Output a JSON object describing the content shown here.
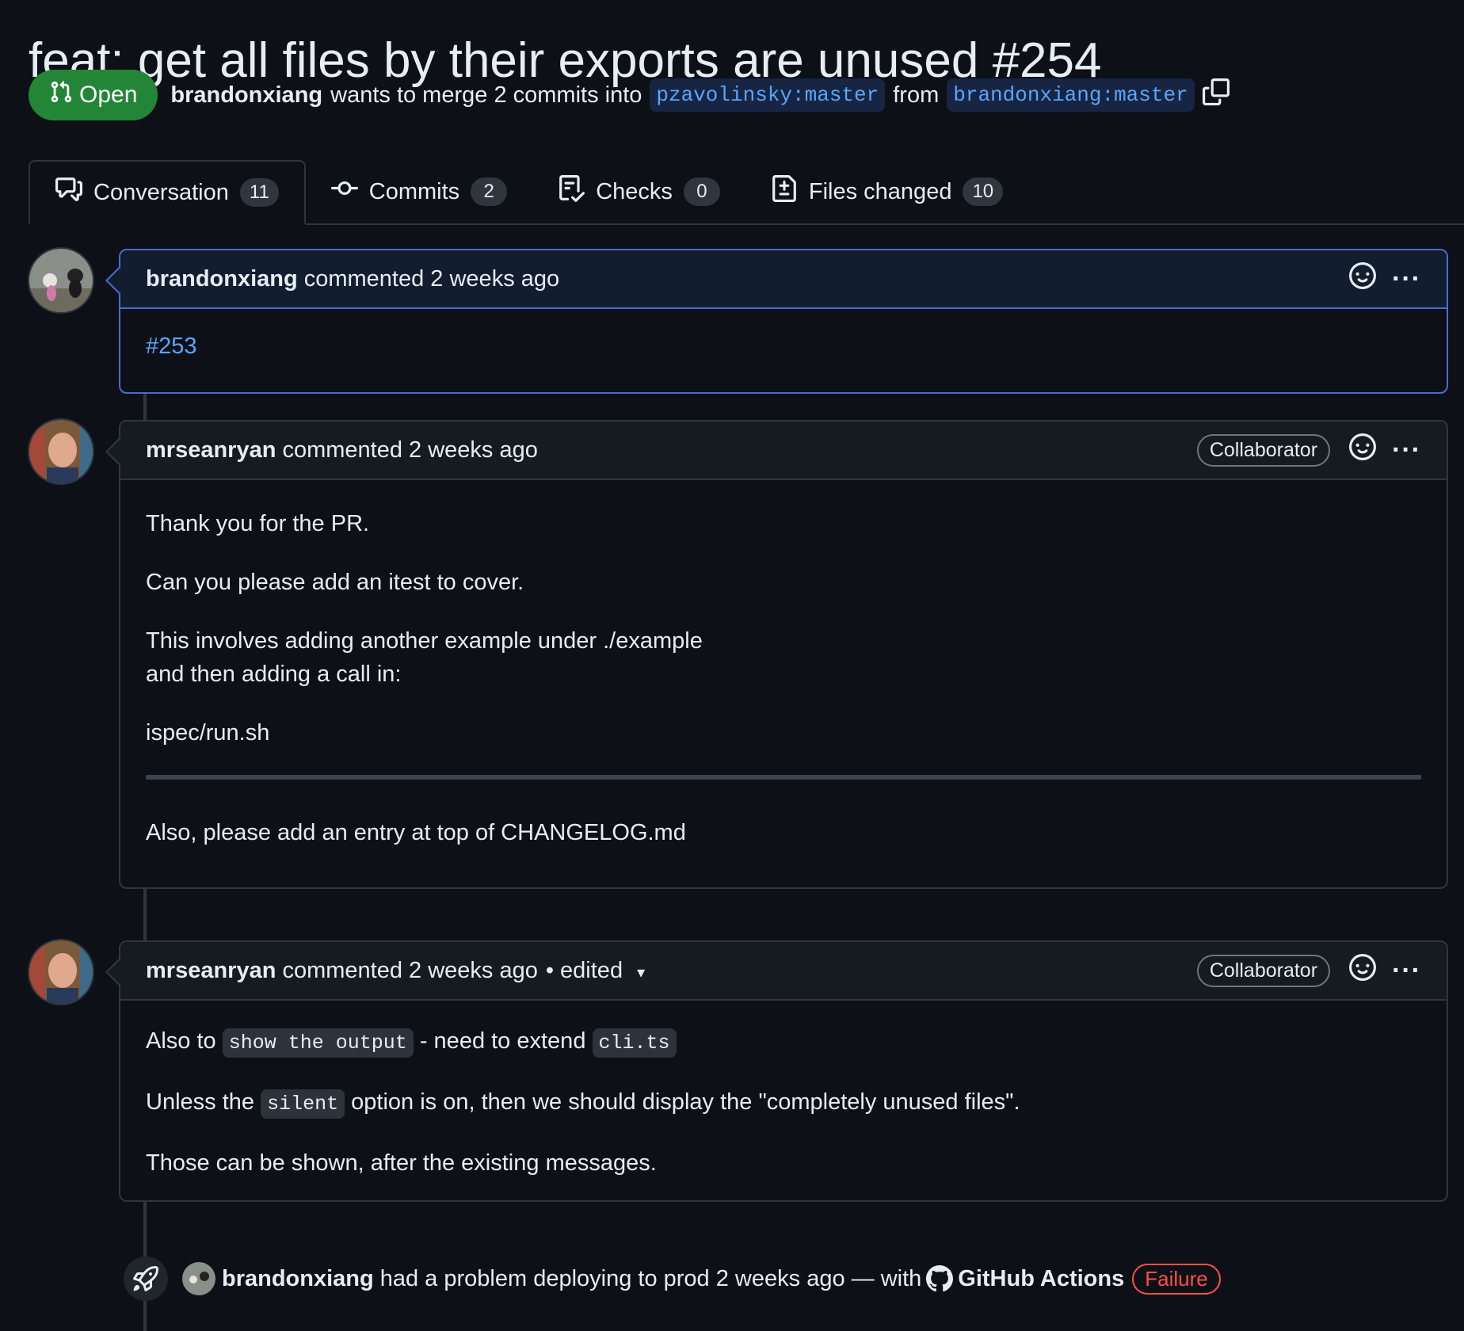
{
  "pr": {
    "title": "feat: get all files by their exports are unused #254",
    "state": "Open",
    "author": "brandonxiang",
    "merge_text": "wants to merge 2 commits into",
    "base_branch": "pzavolinsky:master",
    "from_text": "from",
    "head_branch": "brandonxiang:master"
  },
  "tabs": [
    {
      "label": "Conversation",
      "count": "11",
      "icon": "comment-discussion-icon"
    },
    {
      "label": "Commits",
      "count": "2",
      "icon": "git-commit-icon"
    },
    {
      "label": "Checks",
      "count": "0",
      "icon": "checklist-icon"
    },
    {
      "label": "Files changed",
      "count": "10",
      "icon": "file-diff-icon"
    }
  ],
  "comments": [
    {
      "author": "brandonxiang",
      "meta": "commented 2 weeks ago",
      "body": {
        "link": "#253"
      }
    },
    {
      "author": "mrseanryan",
      "meta": "commented 2 weeks ago",
      "badge": "Collaborator",
      "body": {
        "p1": "Thank you for the PR.",
        "p2": "Can you please add an itest to cover.",
        "p3a": "This involves adding another example under ./example",
        "p3b": "and then adding a call in:",
        "p4": "ispec/run.sh",
        "p5": "Also, please add an entry at top of CHANGELOG.md"
      }
    },
    {
      "author": "mrseanryan",
      "meta": "commented 2 weeks ago",
      "edited": "• edited",
      "badge": "Collaborator",
      "body": {
        "l1a": "Also to",
        "l1code": "show the output",
        "l1b": "- need to extend",
        "l1code2": "cli.ts",
        "l2a": "Unless the",
        "l2code": "silent",
        "l2b": "option is on, then we should display the \"completely unused files\".",
        "l3": "Those can be shown, after the existing messages."
      }
    }
  ],
  "event": {
    "actor": "brandonxiang",
    "text": "had a problem deploying to prod 2 weeks ago — with",
    "app": "GitHub Actions",
    "status": "Failure"
  },
  "colors": {
    "background": "#0d1117",
    "open_green": "#238636",
    "link_blue": "#58a6ff",
    "failure_red": "#f85149",
    "owner_border": "#4b6bd1"
  }
}
